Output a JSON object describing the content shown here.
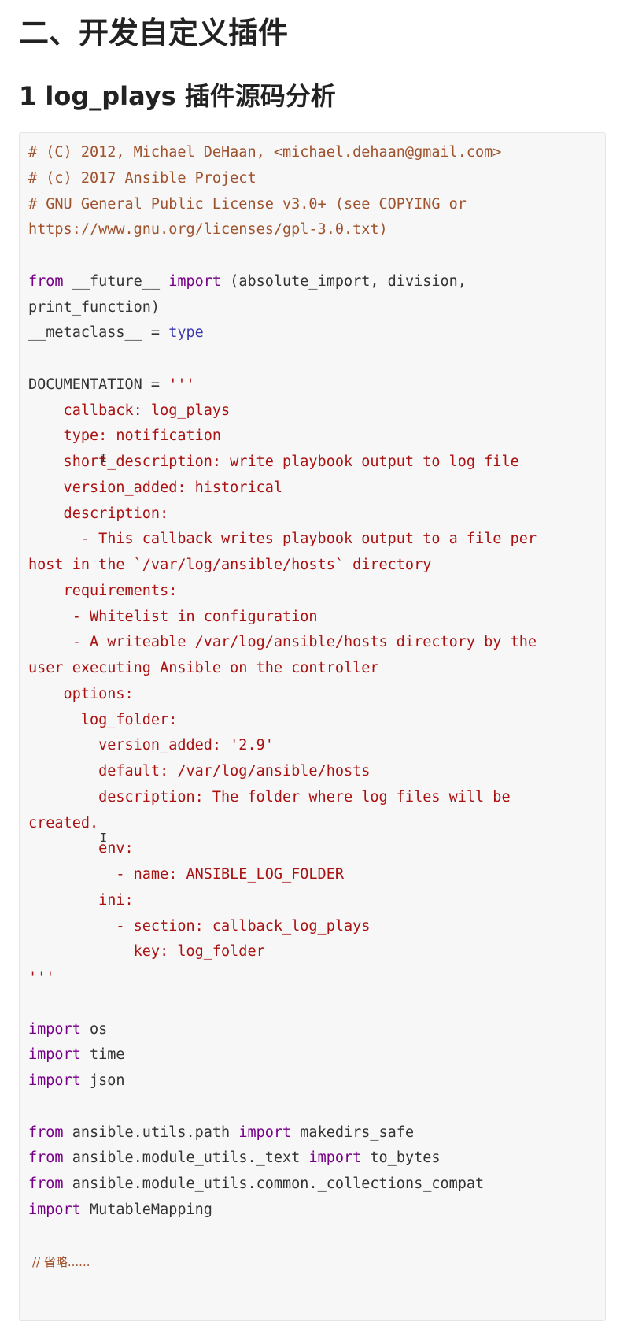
{
  "heading_section": "二、开发自定义插件",
  "heading_sub": "1 log_plays 插件源码分析",
  "code_lines": [
    [
      {
        "t": "# (C) 2012, Michael DeHaan, <michael.dehaan@gmail.com>",
        "k": "comment"
      }
    ],
    [
      {
        "t": "# (c) 2017 Ansible Project",
        "k": "comment"
      }
    ],
    [
      {
        "t": "# GNU General Public License v3.0+ (see COPYING or",
        "k": "comment"
      }
    ],
    [
      {
        "t": "https://www.gnu.org/licenses/gpl-3.0.txt)",
        "k": "comment"
      }
    ],
    [],
    [
      {
        "t": "from",
        "k": "kw"
      },
      {
        "t": " __future__ ",
        "k": "plain"
      },
      {
        "t": "import",
        "k": "kw"
      },
      {
        "t": " (absolute_import, division,",
        "k": "plain"
      }
    ],
    [
      {
        "t": "print_function)",
        "k": "plain"
      }
    ],
    [
      {
        "t": "__metaclass__ = ",
        "k": "plain"
      },
      {
        "t": "type",
        "k": "builtin"
      }
    ],
    [],
    [
      {
        "t": "DOCUMENTATION = ",
        "k": "plain"
      },
      {
        "t": "'''",
        "k": "string"
      }
    ],
    [
      {
        "t": "    callback: log_plays",
        "k": "string"
      }
    ],
    [
      {
        "t": "    type: notification",
        "k": "string"
      }
    ],
    [
      {
        "t": "    short_description: write playbook output to log file",
        "k": "string"
      }
    ],
    [
      {
        "t": "    version_added: historical",
        "k": "string"
      }
    ],
    [
      {
        "t": "    description:",
        "k": "string"
      }
    ],
    [
      {
        "t": "      - This callback writes playbook output to a file per",
        "k": "string"
      }
    ],
    [
      {
        "t": "host in the `/var/log/ansible/hosts` directory",
        "k": "string"
      }
    ],
    [
      {
        "t": "    requirements:",
        "k": "string"
      }
    ],
    [
      {
        "t": "     - Whitelist in configuration",
        "k": "string"
      }
    ],
    [
      {
        "t": "     - A writeable /var/log/ansible/hosts directory by the",
        "k": "string"
      }
    ],
    [
      {
        "t": "user executing Ansible on the controller",
        "k": "string"
      }
    ],
    [
      {
        "t": "    options:",
        "k": "string"
      }
    ],
    [
      {
        "t": "      log_folder:",
        "k": "string"
      }
    ],
    [
      {
        "t": "        version_added: '2.9'",
        "k": "string"
      }
    ],
    [
      {
        "t": "        default: /var/log/ansible/hosts",
        "k": "string"
      }
    ],
    [
      {
        "t": "        description: The folder where log files will be",
        "k": "string"
      }
    ],
    [
      {
        "t": "created.",
        "k": "string"
      }
    ],
    [
      {
        "t": "        env:",
        "k": "string"
      }
    ],
    [
      {
        "t": "          - name: ANSIBLE_LOG_FOLDER",
        "k": "string"
      }
    ],
    [
      {
        "t": "        ini:",
        "k": "string"
      }
    ],
    [
      {
        "t": "          - section: callback_log_plays",
        "k": "string"
      }
    ],
    [
      {
        "t": "            key: log_folder",
        "k": "string"
      }
    ],
    [
      {
        "t": "'''",
        "k": "string"
      }
    ],
    [],
    [
      {
        "t": "import",
        "k": "kw"
      },
      {
        "t": " os",
        "k": "plain"
      }
    ],
    [
      {
        "t": "import",
        "k": "kw"
      },
      {
        "t": " time",
        "k": "plain"
      }
    ],
    [
      {
        "t": "import",
        "k": "kw"
      },
      {
        "t": " json",
        "k": "plain"
      }
    ],
    [],
    [
      {
        "t": "from",
        "k": "kw"
      },
      {
        "t": " ansible.utils.path ",
        "k": "plain"
      },
      {
        "t": "import",
        "k": "kw"
      },
      {
        "t": " makedirs_safe",
        "k": "plain"
      }
    ],
    [
      {
        "t": "from",
        "k": "kw"
      },
      {
        "t": " ansible.module_utils._text ",
        "k": "plain"
      },
      {
        "t": "import",
        "k": "kw"
      },
      {
        "t": " to_bytes",
        "k": "plain"
      }
    ],
    [
      {
        "t": "from",
        "k": "kw"
      },
      {
        "t": " ansible.module_utils.common._collections_compat",
        "k": "plain"
      }
    ],
    [
      {
        "t": "import",
        "k": "kw"
      },
      {
        "t": " MutableMapping",
        "k": "plain"
      }
    ]
  ],
  "code_note": "// 省略......",
  "colors": {
    "comment": "#a0522d",
    "keyword": "#770088",
    "builtin": "#3a3ab0",
    "string": "#aa1111",
    "plain": "#333333",
    "code_background": "#f7f7f7"
  },
  "icons": {
    "text_cursor": "I-beam-cursor-icon"
  }
}
